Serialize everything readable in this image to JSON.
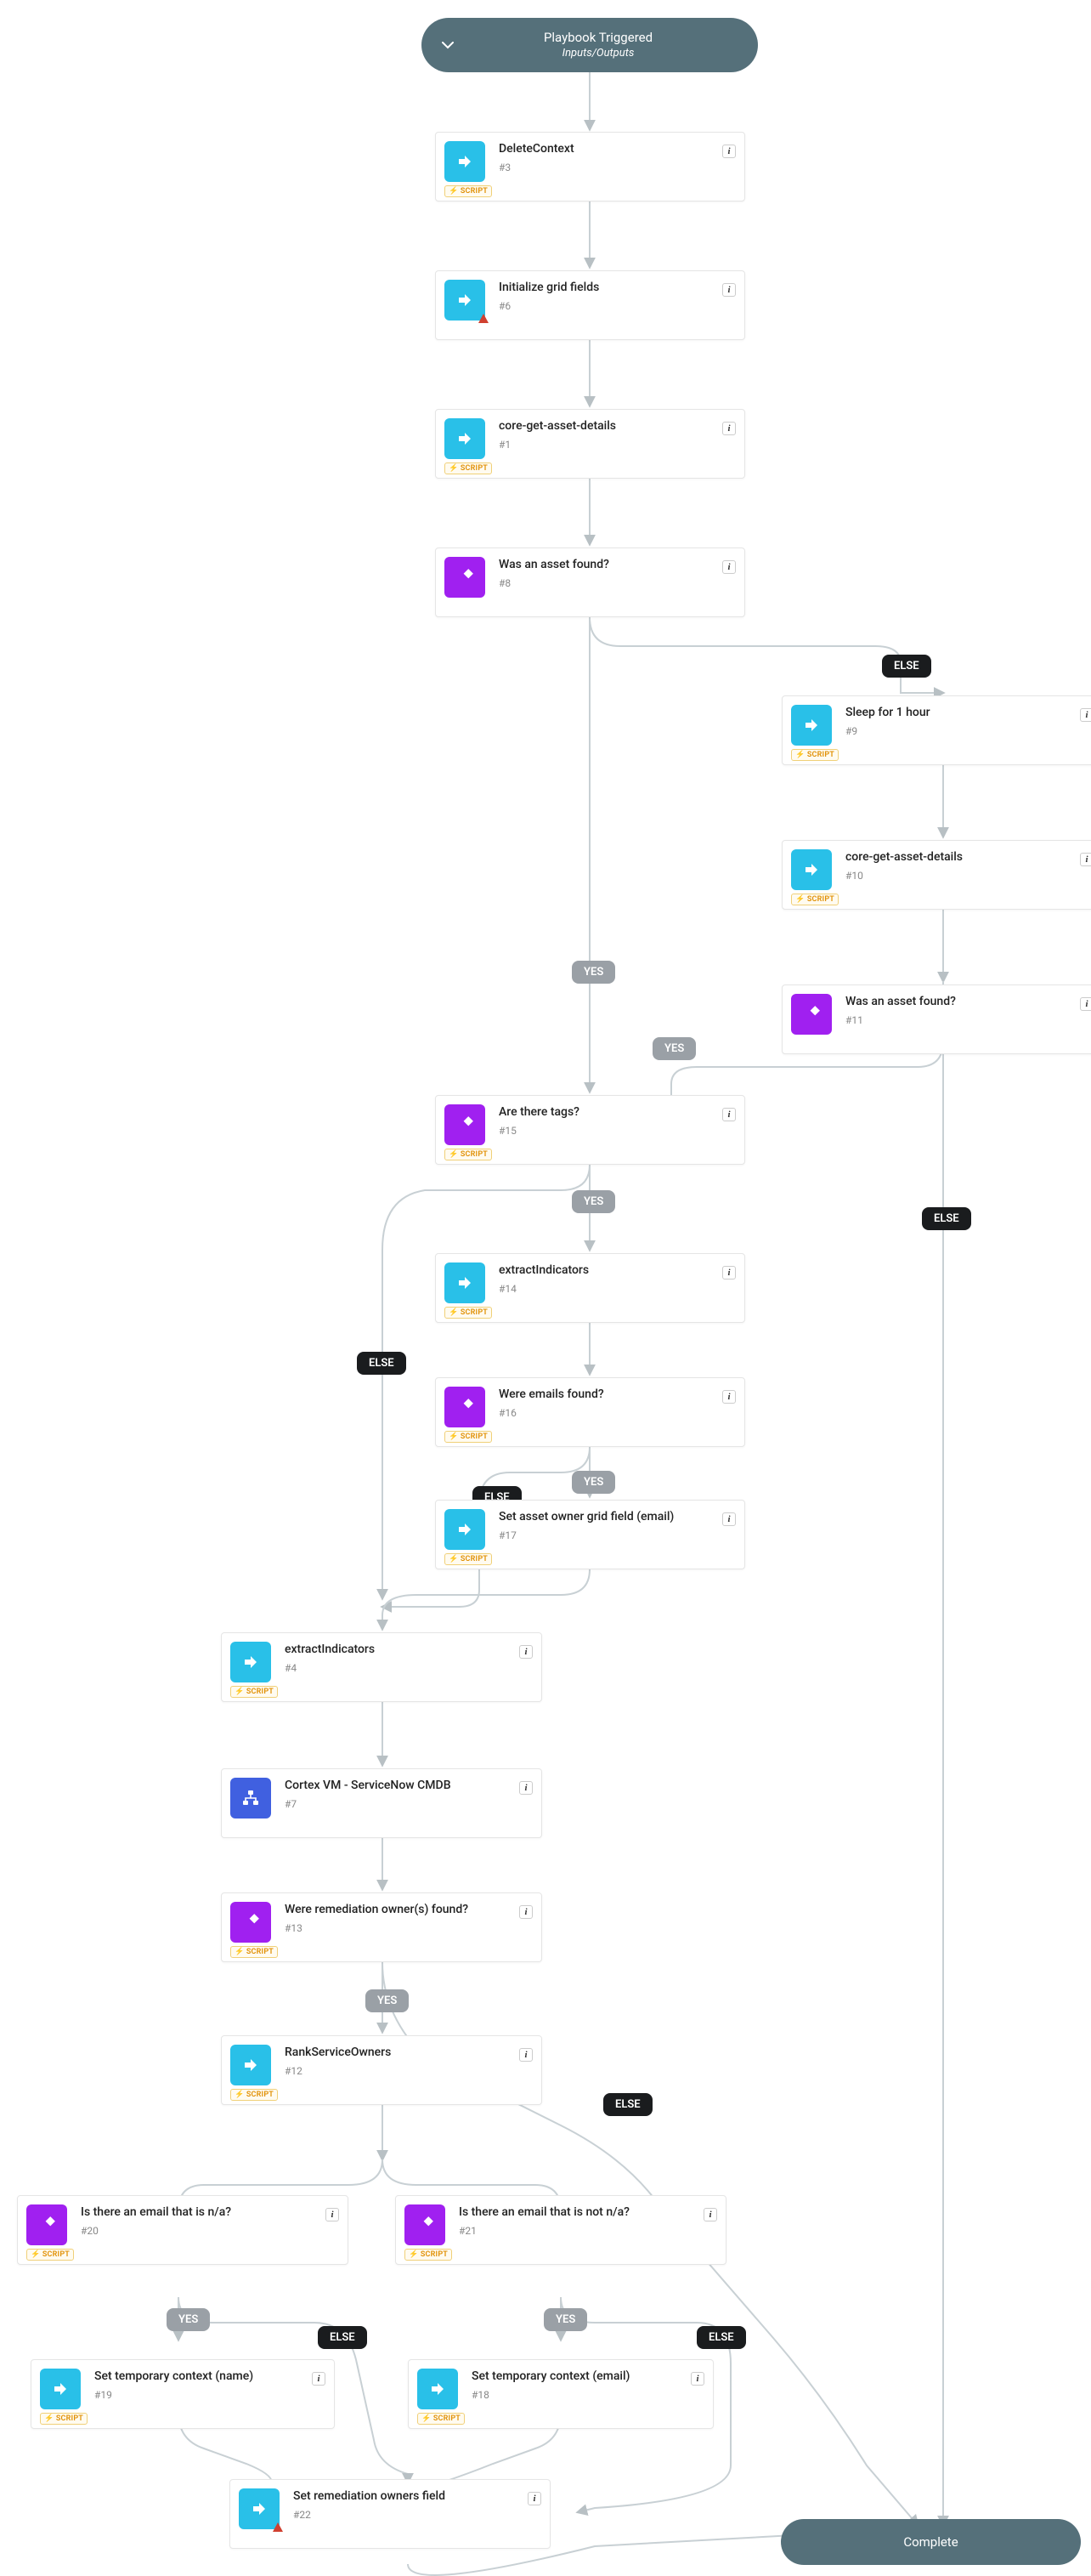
{
  "trigger": {
    "title": "Playbook Triggered",
    "subtitle": "Inputs/Outputs"
  },
  "complete": {
    "label": "Complete"
  },
  "labels": {
    "yes": "YES",
    "else": "ELSE"
  },
  "script_tag": "SCRIPT",
  "nodes": {
    "n3": {
      "title": "DeleteContext",
      "num": "#3"
    },
    "n6": {
      "title": "Initialize grid fields",
      "num": "#6"
    },
    "n1": {
      "title": "core-get-asset-details",
      "num": "#1"
    },
    "n8": {
      "title": "Was an asset found?",
      "num": "#8"
    },
    "n9": {
      "title": "Sleep for 1 hour",
      "num": "#9"
    },
    "n10": {
      "title": "core-get-asset-details",
      "num": "#10"
    },
    "n11": {
      "title": "Was an asset found?",
      "num": "#11"
    },
    "n15": {
      "title": "Are there tags?",
      "num": "#15"
    },
    "n14": {
      "title": "extractIndicators",
      "num": "#14"
    },
    "n16": {
      "title": "Were emails found?",
      "num": "#16"
    },
    "n17": {
      "title": "Set asset owner grid field (email)",
      "num": "#17"
    },
    "n4": {
      "title": "extractIndicators",
      "num": "#4"
    },
    "n7": {
      "title": "Cortex VM - ServiceNow CMDB",
      "num": "#7"
    },
    "n13": {
      "title": "Were remediation owner(s) found?",
      "num": "#13"
    },
    "n12": {
      "title": "RankServiceOwners",
      "num": "#12"
    },
    "n20": {
      "title": "Is there an email that is n/a?",
      "num": "#20"
    },
    "n21": {
      "title": "Is there an email that is not n/a?",
      "num": "#21"
    },
    "n19": {
      "title": "Set temporary context (name)",
      "num": "#19"
    },
    "n18": {
      "title": "Set temporary context (email)",
      "num": "#18"
    },
    "n22": {
      "title": "Set remediation owners field",
      "num": "#22"
    }
  },
  "flow": [
    [
      "trigger",
      "n3",
      null
    ],
    [
      "n3",
      "n6",
      null
    ],
    [
      "n6",
      "n1",
      null
    ],
    [
      "n1",
      "n8",
      null
    ],
    [
      "n8",
      "n15",
      "YES"
    ],
    [
      "n8",
      "n9",
      "ELSE"
    ],
    [
      "n9",
      "n10",
      null
    ],
    [
      "n10",
      "n11",
      null
    ],
    [
      "n11",
      "n15",
      "YES"
    ],
    [
      "n11",
      "complete",
      "ELSE"
    ],
    [
      "n15",
      "n14",
      "YES"
    ],
    [
      "n15",
      "n4",
      "ELSE"
    ],
    [
      "n14",
      "n16",
      null
    ],
    [
      "n16",
      "n17",
      "YES"
    ],
    [
      "n16",
      "n4",
      "ELSE"
    ],
    [
      "n17",
      "n4",
      null
    ],
    [
      "n4",
      "n7",
      null
    ],
    [
      "n7",
      "n13",
      null
    ],
    [
      "n13",
      "n12",
      "YES"
    ],
    [
      "n13",
      "complete",
      "ELSE"
    ],
    [
      "n12",
      "n20",
      null
    ],
    [
      "n12",
      "n21",
      null
    ],
    [
      "n20",
      "n19",
      "YES"
    ],
    [
      "n20",
      "n22",
      "ELSE"
    ],
    [
      "n21",
      "n18",
      "YES"
    ],
    [
      "n21",
      "n22",
      "ELSE"
    ],
    [
      "n19",
      "n22",
      null
    ],
    [
      "n18",
      "n22",
      null
    ],
    [
      "n22",
      "complete",
      null
    ]
  ]
}
